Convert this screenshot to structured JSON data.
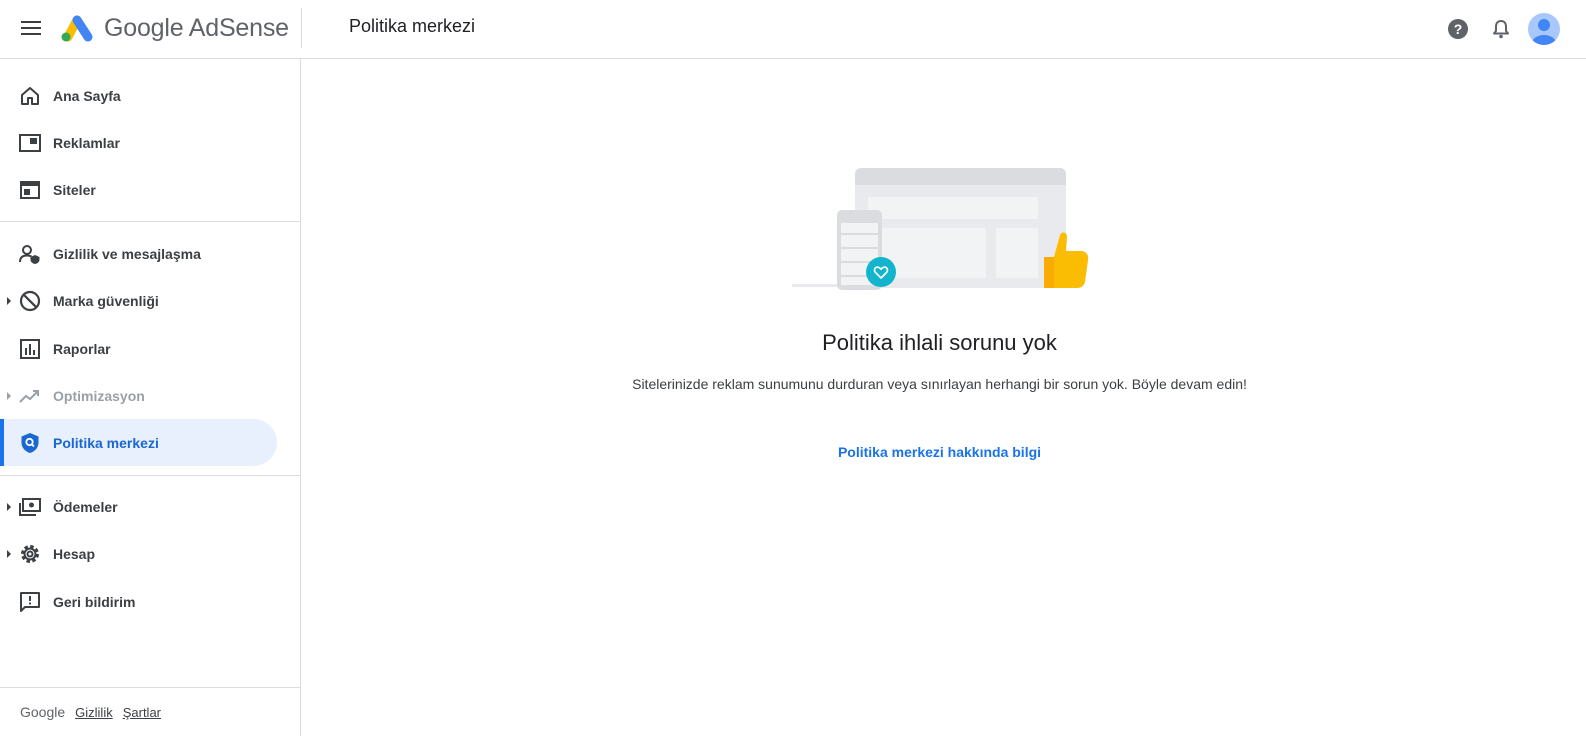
{
  "header": {
    "app_name": "Google AdSense",
    "page_title": "Politika merkezi",
    "icons": [
      "menu-icon",
      "help-icon",
      "notifications-icon",
      "account-avatar"
    ]
  },
  "sidebar": {
    "items": [
      {
        "label": "Ana Sayfa",
        "icon": "home-icon"
      },
      {
        "label": "Reklamlar",
        "icon": "ads-icon"
      },
      {
        "label": "Siteler",
        "icon": "sites-icon"
      },
      {
        "label": "Gizlilik ve mesajlaşma",
        "icon": "privacy-icon"
      },
      {
        "label": "Marka güvenliği",
        "icon": "block-icon",
        "expandable": true
      },
      {
        "label": "Raporlar",
        "icon": "reports-icon"
      },
      {
        "label": "Optimizasyon",
        "icon": "trending-icon",
        "expandable": true,
        "disabled": true
      },
      {
        "label": "Politika merkezi",
        "icon": "policy-shield-icon",
        "active": true
      },
      {
        "label": "Ödemeler",
        "icon": "payments-icon",
        "expandable": true
      },
      {
        "label": "Hesap",
        "icon": "settings-icon",
        "expandable": true
      },
      {
        "label": "Geri bildirim",
        "icon": "feedback-icon"
      }
    ],
    "footer": {
      "brand": "Google",
      "privacy": "Gizlilik",
      "terms": "Şartlar"
    }
  },
  "main": {
    "empty_state_title": "Politika ihlali sorunu yok",
    "empty_state_description": "Sitelerinizde reklam sunumunu durduran veya sınırlayan herhangi bir sorun yok. Böyle devam edin!",
    "learn_more_link": "Politika merkezi hakkında bilgi"
  },
  "colors": {
    "accent": "#1a73e8",
    "active_bg": "#e8f0fe",
    "badge_teal": "#12b5cb",
    "thumb_yellow": "#fbbc04"
  }
}
